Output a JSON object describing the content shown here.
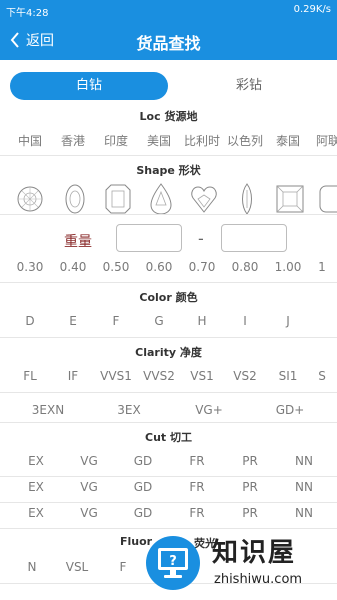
{
  "status": {
    "time": "下午4:28",
    "speed": "0.29K/s",
    "battery": ""
  },
  "header": {
    "back_label": "返回",
    "title": "货品查找"
  },
  "tabs": {
    "white": "白钻",
    "color": "彩钻"
  },
  "sections": {
    "loc": "Loc 货源地",
    "shape": "Shape 形状",
    "weight": "重量",
    "color": "Color 颜色",
    "clarity": "Clarity 净度",
    "cut": "Cut 切工",
    "fluor_prefix": "Fluor",
    "fluor_suffix": "荧光"
  },
  "loc_options": [
    "中国",
    "香港",
    "印度",
    "美国",
    "比利时",
    "以色列",
    "泰国",
    "阿联"
  ],
  "weight_options": [
    "0.30",
    "0.40",
    "0.50",
    "0.60",
    "0.70",
    "0.80",
    "1.00",
    "1"
  ],
  "color_options": [
    "D",
    "E",
    "F",
    "G",
    "H",
    "I",
    "J"
  ],
  "clarity_options": [
    "FL",
    "IF",
    "VVS1",
    "VVS2",
    "VS1",
    "VS2",
    "SI1",
    "S"
  ],
  "quality_options": [
    "3EXN",
    "3EX",
    "VG+",
    "GD+"
  ],
  "cut_rows": [
    [
      "EX",
      "VG",
      "GD",
      "FR",
      "PR",
      "NN"
    ],
    [
      "EX",
      "VG",
      "GD",
      "FR",
      "PR",
      "NN"
    ],
    [
      "EX",
      "VG",
      "GD",
      "FR",
      "PR",
      "NN"
    ]
  ],
  "fluor_options": [
    "N",
    "VSL",
    "F"
  ],
  "watermark": {
    "cn": "知识屋",
    "en": "zhishiwu.com"
  },
  "accent": "#1a8fe0"
}
